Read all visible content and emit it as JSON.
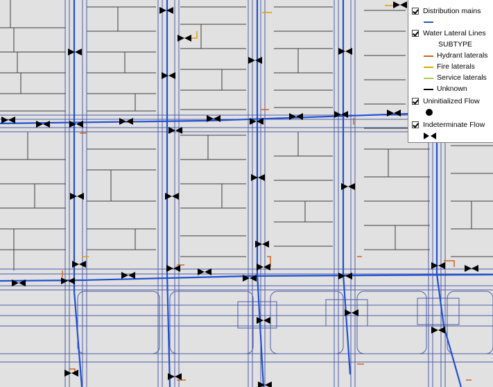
{
  "legend": {
    "distribution_mains": {
      "label": "Distribution mains",
      "checked": true,
      "color": "#2255cc"
    },
    "water_lateral_lines": {
      "label": "Water Lateral Lines",
      "checked": true
    },
    "subtype_heading": "SUBTYPE",
    "subtypes": [
      {
        "label": "Hydrant laterals",
        "color": "#d2601e"
      },
      {
        "label": "Fire laterals",
        "color": "#e0a000"
      },
      {
        "label": "Service laterals",
        "color": "#b5c84a"
      },
      {
        "label": "Unknown",
        "color": "#000000"
      }
    ],
    "uninitialized_flow": {
      "label": "Uninitialized Flow",
      "checked": true,
      "icon": "filled-circle-icon"
    },
    "indeterminate_flow": {
      "label": "Indeterminate Flow",
      "checked": true,
      "icon": "bowtie-icon"
    }
  },
  "colors": {
    "background": "#e1e1e1",
    "parcel_lines": "#3a3a3a",
    "pipe_outline": "#4a5aa8",
    "main": "#1f4fd1",
    "hydrant": "#d2601e",
    "fire": "#e0a000"
  }
}
